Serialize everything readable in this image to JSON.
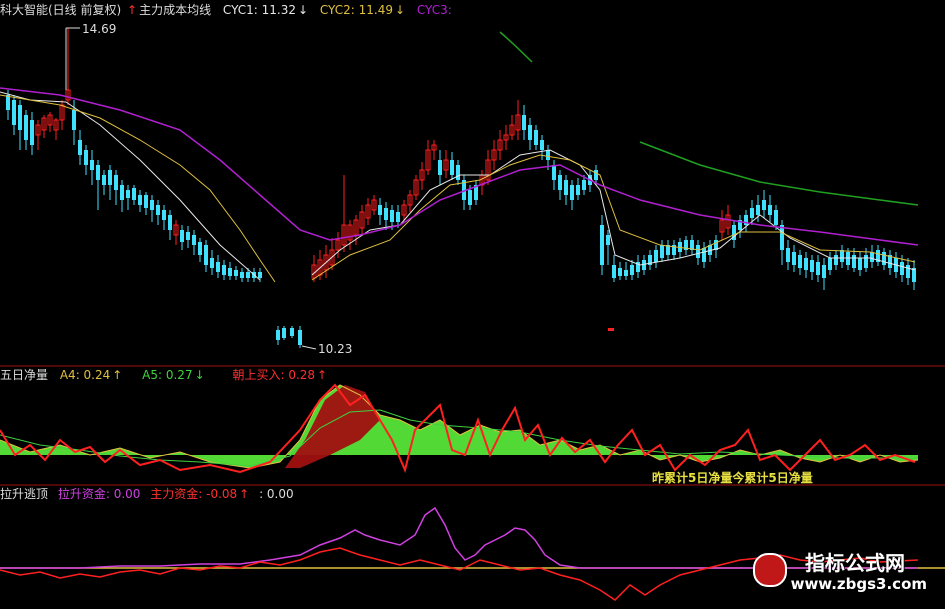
{
  "main_panel": {
    "title": "科大智能(日线 前复权)",
    "indicator_name": "主力成本均线",
    "cyc1_label": "CYC1: 11.32",
    "cyc1_arrow": "↓",
    "cyc2_label": "CYC2: 11.49",
    "cyc2_arrow": "↓",
    "cyc3_label": "CYC3:",
    "high_annotation": "14.69",
    "low_annotation": "10.23"
  },
  "panel2": {
    "name": "五日净量",
    "a4_label": "A4: 0.24",
    "a4_arrow": "↑",
    "a5_label": "A5: 0.27",
    "a5_arrow": "↓",
    "buy_label": "朝上买入: 0.28",
    "buy_arrow": "↑",
    "caption": "昨累计5日净量今累计5日净量"
  },
  "panel3": {
    "name": "拉升逃顶",
    "lift_label": "拉升资金: 0.00",
    "main_label": "主力资金: -0.08",
    "main_arrow": "↑",
    "extra_label": ": 0.00"
  },
  "watermark": {
    "line1": "指标公式网",
    "line2": "www.zbgs3.com"
  },
  "colors": {
    "up": "#ff2020",
    "down": "#40e0ff",
    "ma_white": "#e8e8e8",
    "ma_yellow": "#e0c040",
    "ma_purple": "#b020d0",
    "ma_green": "#20a020",
    "divider": "#a01010",
    "fill_green": "#60ff40",
    "fill_red": "#a01010"
  }
}
